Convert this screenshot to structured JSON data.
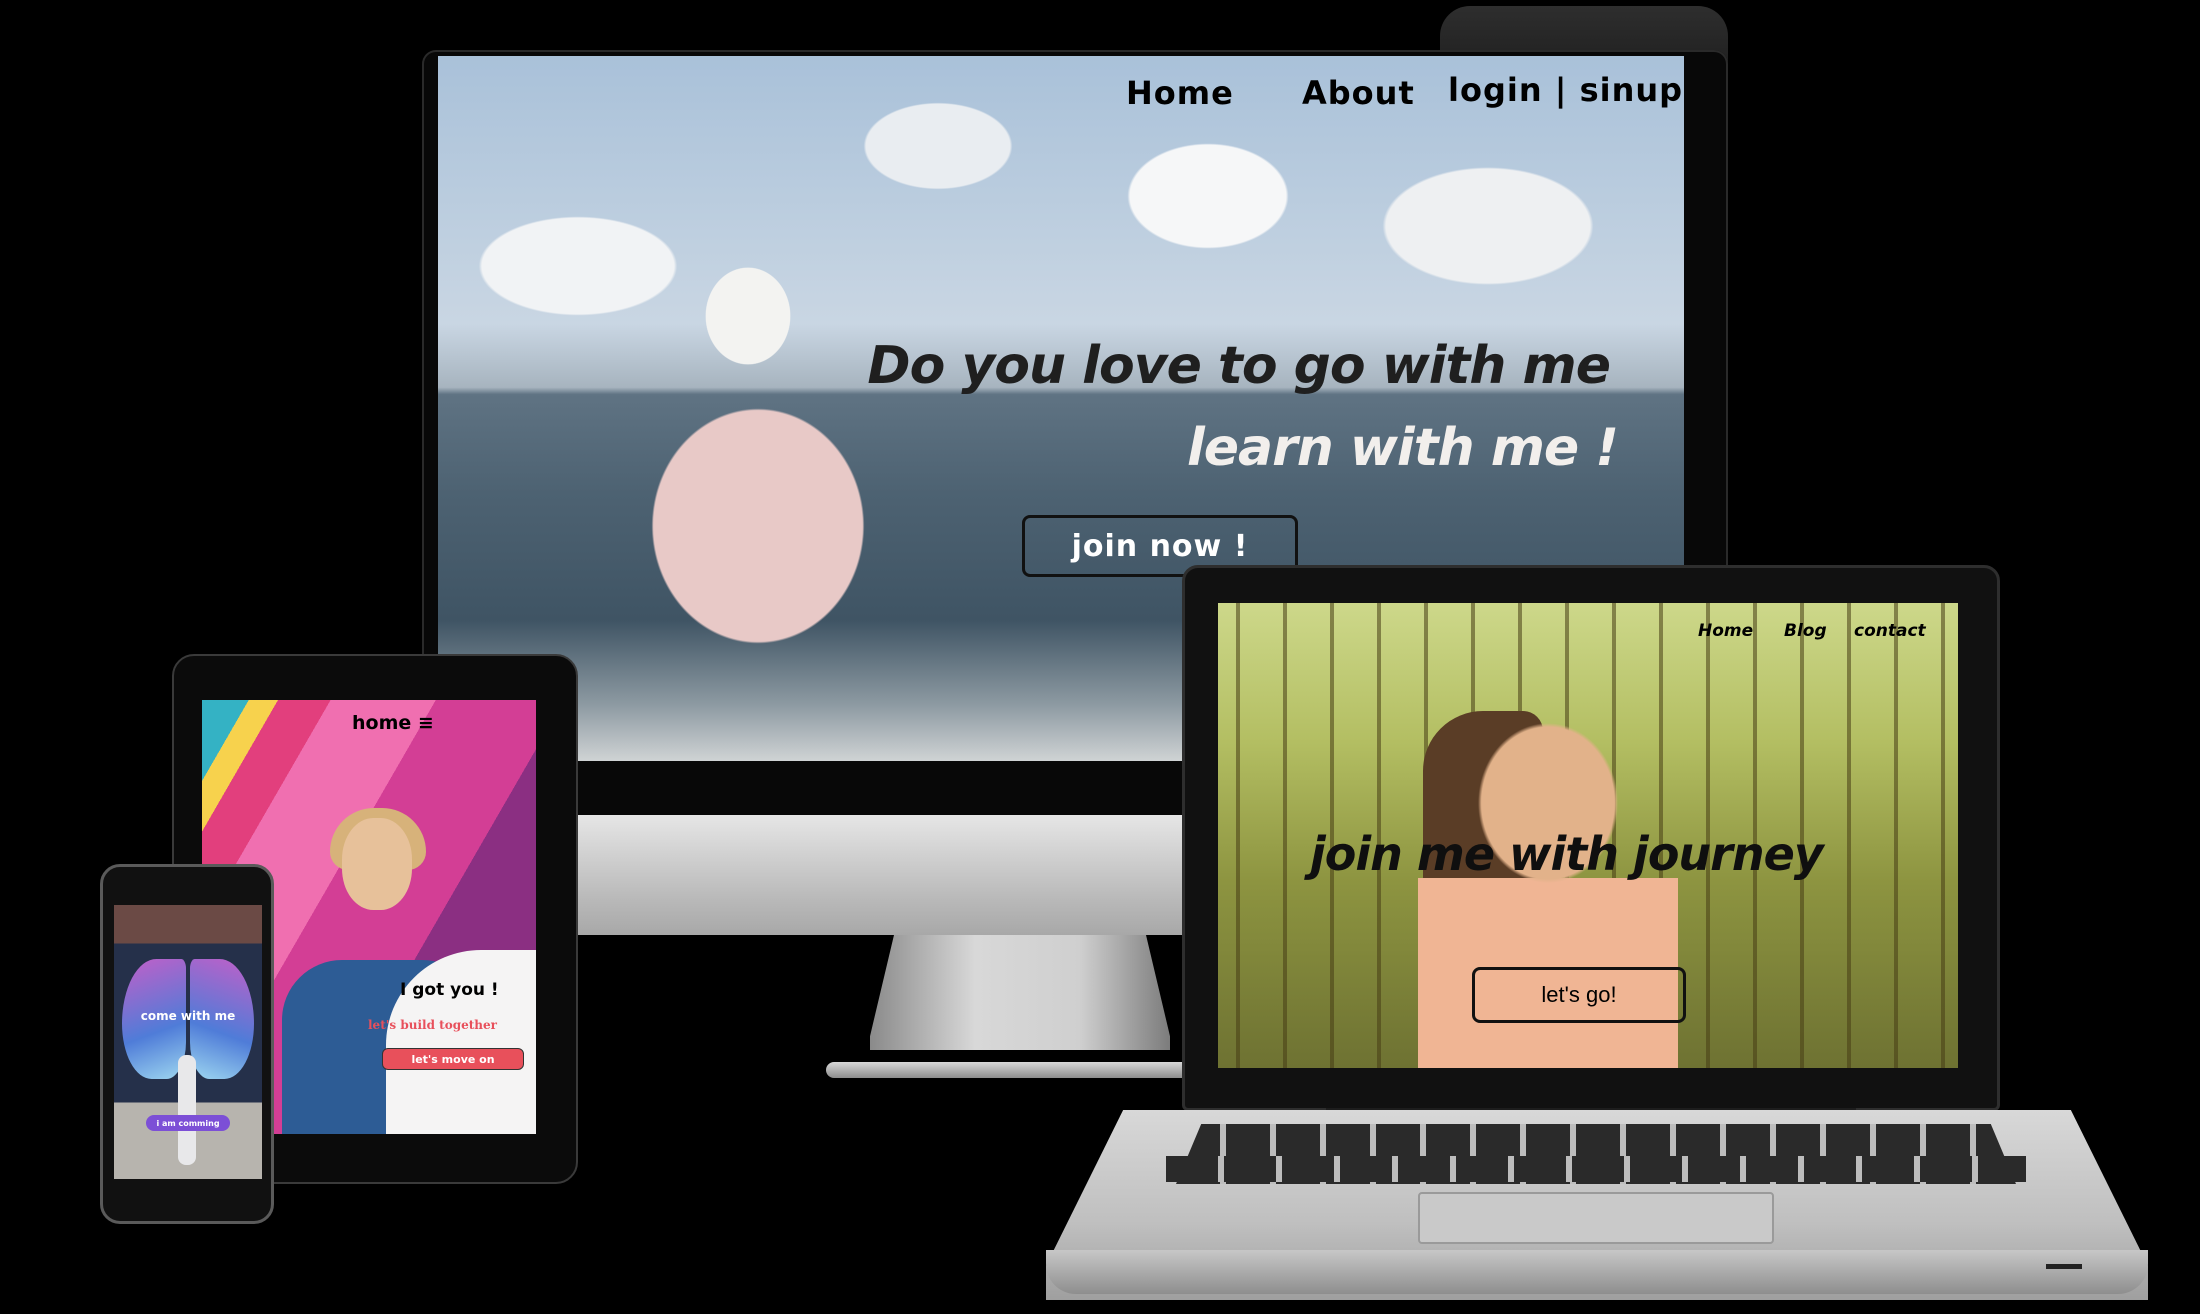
{
  "desktop": {
    "nav": {
      "home": "Home",
      "about": "About",
      "auth": "login | sinup"
    },
    "headline_1": "Do you love to go with me",
    "headline_2": "learn with me !",
    "cta": "join now !"
  },
  "tablet": {
    "nav": {
      "home": "home ≡"
    },
    "card_title": "I got you !",
    "card_subtitle": "let's build together",
    "cta": "let's move on"
  },
  "phone": {
    "headline": "come with me",
    "cta": "i am comming"
  },
  "laptop": {
    "nav": {
      "home": "Home",
      "blog": "Blog",
      "contact": "contact"
    },
    "headline": "join me with journey",
    "cta": "let's go!"
  },
  "colors": {
    "background": "#000000",
    "tablet_accent": "#e8505b",
    "phone_accent": "#7c4fd6"
  }
}
